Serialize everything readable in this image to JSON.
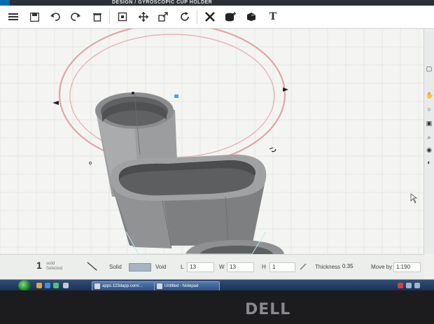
{
  "window": {
    "title": "GYROSCOPIC CUP HOLDER",
    "title_prefix": "DESIGN"
  },
  "toolbar": {
    "items": [
      {
        "name": "menu-icon",
        "label": "menu"
      },
      {
        "name": "save-icon",
        "label": "save"
      },
      {
        "name": "undo-icon",
        "label": "undo"
      },
      {
        "name": "redo-icon",
        "label": "redo"
      },
      {
        "name": "delete-icon",
        "label": "delete"
      },
      {
        "name": "select-icon",
        "label": "select"
      },
      {
        "name": "move-icon",
        "label": "move"
      },
      {
        "name": "scale-icon",
        "label": "scale"
      },
      {
        "name": "rotate-icon",
        "label": "rotate"
      },
      {
        "name": "tools-icon",
        "label": "tools"
      },
      {
        "name": "add-shape-icon",
        "label": "add shape"
      },
      {
        "name": "combine-icon",
        "label": "combine"
      },
      {
        "name": "text-icon",
        "label": "T"
      }
    ]
  },
  "side_tools": [
    {
      "name": "view-icon"
    },
    {
      "name": "hand-pan-icon"
    },
    {
      "name": "zoom-icon"
    },
    {
      "name": "fit-icon"
    },
    {
      "name": "zoom-tool-icon"
    },
    {
      "name": "eye-icon"
    },
    {
      "name": "material-icon"
    }
  ],
  "properties": {
    "count_value": "1",
    "count_label": "solid",
    "count_sublabel": "Selected",
    "solid_label": "Solid",
    "void_label": "Void",
    "length_label": "L",
    "length_value": "13",
    "width_label": "W",
    "width_value": "13",
    "height_label": "H",
    "height_value": "1",
    "thickness_label": "Thickness",
    "thickness_value": "0.35",
    "move_label": "Move by",
    "move_value": "1.190"
  },
  "taskbar": {
    "tasks": [
      {
        "label": "apps.123dapp.com/..."
      },
      {
        "label": "Untitled - Notepad"
      }
    ]
  },
  "bezel": {
    "brand": "DELL"
  },
  "colors": {
    "accent_ring": "#e69a9a",
    "model_gray": "#8b8d8f",
    "grid_line": "#dfe3e0",
    "selection_blue": "#4aa3df"
  }
}
